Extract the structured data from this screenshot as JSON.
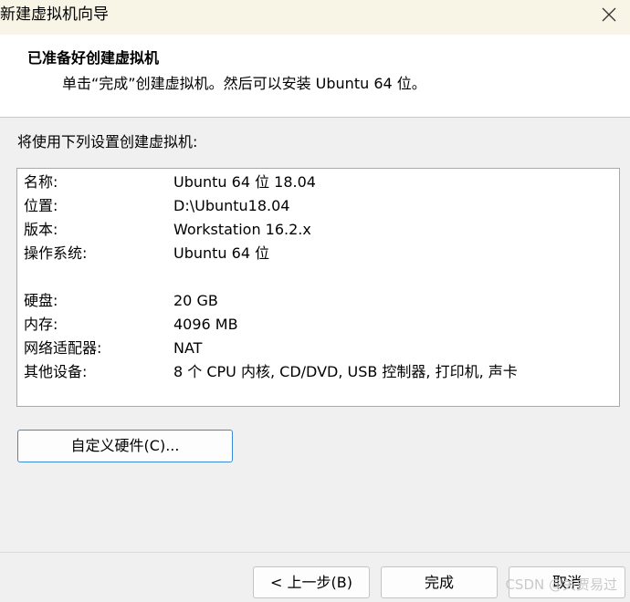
{
  "window": {
    "title": "新建虚拟机向导",
    "close_icon": "close-icon"
  },
  "header": {
    "title": "已准备好创建虚拟机",
    "subtitle": "单击“完成”创建虚拟机。然后可以安装 Ubuntu 64 位。"
  },
  "intro": "将使用下列设置创建虚拟机:",
  "summary": {
    "rows": [
      {
        "key": "名称:",
        "value": "Ubuntu 64 位 18.04"
      },
      {
        "key": "位置:",
        "value": "D:\\Ubuntu18.04"
      },
      {
        "key": "版本:",
        "value": "Workstation 16.2.x"
      },
      {
        "key": "操作系统:",
        "value": "Ubuntu 64 位"
      },
      {
        "key": "硬盘:",
        "value": "20 GB"
      },
      {
        "key": "内存:",
        "value": "4096 MB"
      },
      {
        "key": "网络适配器:",
        "value": "NAT"
      },
      {
        "key": "其他设备:",
        "value": "8 个 CPU 内核, CD/DVD, USB 控制器, 打印机, 声卡"
      }
    ]
  },
  "buttons": {
    "customize_label": "自定义硬件(C)...",
    "back_label": "< 上一步(B)",
    "finish_label": "完成",
    "cancel_label": "取消"
  },
  "watermark": "CSDN @关贾易过"
}
